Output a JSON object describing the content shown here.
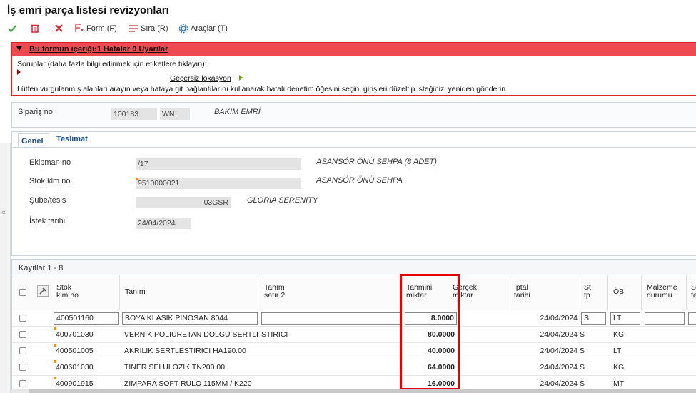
{
  "title": "İş emri parça listesi revizyonları",
  "toolbar": {
    "form_label": "Form (F)",
    "sira_label": "Sıra (R)",
    "araclar_label": "Araçlar (T)"
  },
  "errors": {
    "header": "Bu formun içeriği:1 Hatalar 0 Uyarılar",
    "line1": "Sorunlar (daha fazla bilgi edinmek için etiketlere tıklayın):",
    "link": "Geçersiz lokasyon",
    "line3": "Lütfen vurgulanmış alanları arayın veya hataya git bağlantılarını kullanarak hatalı denetim öğesini seçin, girişleri düzeltip isteğinizi yeniden gönderin."
  },
  "order": {
    "label": "Sipariş no",
    "number": "100183",
    "type": "WN",
    "description": "BAKIM EMRİ"
  },
  "tabs": [
    "Genel",
    "Teslimat"
  ],
  "general": {
    "equipment_label": "Ekipman no",
    "equipment_value": "/17",
    "equipment_desc": "ASANSÖR ÖNÜ SEHPA (8 ADET)",
    "stock_label": "Stok klm no",
    "stock_value": "9510000021",
    "stock_desc": "ASANSÖR ÖNÜ SEHPA",
    "branch_label": "Şube/tesis",
    "branch_value": "03GSR",
    "branch_desc": "GLORIA SERENITY",
    "date_label": "İstek tarihi",
    "date_value": "24/04/2024"
  },
  "grid": {
    "records": "Kayıtlar 1 - 8",
    "headers": {
      "stock": [
        "Stok",
        "klm no"
      ],
      "desc": "Tanım",
      "desc2": [
        "Tanım",
        "satır 2"
      ],
      "estimated": [
        "Tahmini",
        "miktar"
      ],
      "actual": [
        "Gerçek",
        "miktar"
      ],
      "cancel": [
        "İptal",
        "tarihi"
      ],
      "st": [
        "St",
        "tp"
      ],
      "ob": "ÖB",
      "material": [
        "Malzeme",
        "durumu"
      ],
      "extra": [
        "S",
        "fe"
      ]
    },
    "rows": [
      {
        "stock": "400501160",
        "desc": "BOYA KLASIK PINOSAN 8044",
        "desc2": "",
        "qty": "8.0000",
        "date": "24/04/2024",
        "st": "S",
        "ob": "LT"
      },
      {
        "stock": "400701030",
        "desc": "VERNIK POLIURETAN DOLGU SERTLE",
        "desc2": "STIRICI",
        "qty": "80.0000",
        "date": "24/04/2024",
        "st": "S",
        "ob": "KG"
      },
      {
        "stock": "400501005",
        "desc": "AKRILIK SERTLESTIRICI HA190.00",
        "desc2": "",
        "qty": "40.0000",
        "date": "24/04/2024",
        "st": "S",
        "ob": "LT"
      },
      {
        "stock": "400601030",
        "desc": "TINER SELULOZIK TN200.00",
        "desc2": "",
        "qty": "64.0000",
        "date": "24/04/2024",
        "st": "S",
        "ob": "KG"
      },
      {
        "stock": "400901915",
        "desc": "ZIMPARA SOFT RULO 115MM / K220",
        "desc2": "",
        "qty": "16.0000",
        "date": "24/04/2024",
        "st": "S",
        "ob": "MT"
      }
    ]
  }
}
